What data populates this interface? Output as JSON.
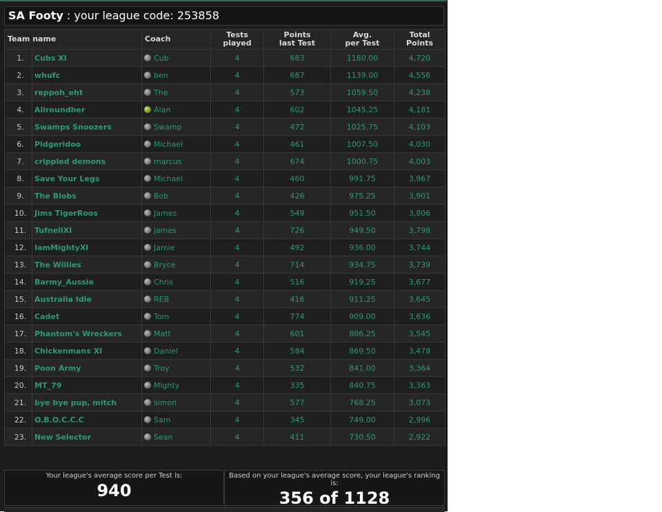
{
  "header": {
    "league_name": "SA Footy",
    "separator": " : ",
    "code_prefix": "your league code: ",
    "code": "253858"
  },
  "columns": {
    "team": "Team name",
    "coach": "Coach",
    "tests_line1": "Tests",
    "tests_line2": "played",
    "points_line1": "Points",
    "points_line2": "last Test",
    "avg_line1": "Avg.",
    "avg_line2": "per Test",
    "total_line1": "Total",
    "total_line2": "Points"
  },
  "rows": [
    {
      "rank": "1.",
      "team": "Cubs XI",
      "coach": "Cub",
      "coach_status": "grey",
      "tests": "4",
      "last": "683",
      "avg": "1180.00",
      "total": "4,720"
    },
    {
      "rank": "2.",
      "team": "whufc",
      "coach": "ben",
      "coach_status": "grey",
      "tests": "4",
      "last": "687",
      "avg": "1139.00",
      "total": "4,556"
    },
    {
      "rank": "3.",
      "team": "reppoh_eht",
      "coach": "The",
      "coach_status": "grey",
      "tests": "4",
      "last": "573",
      "avg": "1059.50",
      "total": "4,238"
    },
    {
      "rank": "4.",
      "team": "Allroundher",
      "coach": "Alan",
      "coach_status": "green",
      "tests": "4",
      "last": "602",
      "avg": "1045.25",
      "total": "4,181"
    },
    {
      "rank": "5.",
      "team": "Swamps Snoozers",
      "coach": "Swamp",
      "coach_status": "grey",
      "tests": "4",
      "last": "472",
      "avg": "1025.75",
      "total": "4,103"
    },
    {
      "rank": "6.",
      "team": "Pidgeridoo",
      "coach": "Michael",
      "coach_status": "grey",
      "tests": "4",
      "last": "461",
      "avg": "1007.50",
      "total": "4,030"
    },
    {
      "rank": "7.",
      "team": "crippled demons",
      "coach": "marcus",
      "coach_status": "grey",
      "tests": "4",
      "last": "674",
      "avg": "1000.75",
      "total": "4,003"
    },
    {
      "rank": "8.",
      "team": "Save Your Legs",
      "coach": "Michael",
      "coach_status": "grey",
      "tests": "4",
      "last": "460",
      "avg": "991.75",
      "total": "3,967"
    },
    {
      "rank": "9.",
      "team": "The Blobs",
      "coach": "Bob",
      "coach_status": "grey",
      "tests": "4",
      "last": "426",
      "avg": "975.25",
      "total": "3,901"
    },
    {
      "rank": "10.",
      "team": "Jims TigerRoos",
      "coach": "James",
      "coach_status": "grey",
      "tests": "4",
      "last": "549",
      "avg": "951.50",
      "total": "3,806"
    },
    {
      "rank": "11.",
      "team": "TufnellXI",
      "coach": "james",
      "coach_status": "grey",
      "tests": "4",
      "last": "726",
      "avg": "949.50",
      "total": "3,798"
    },
    {
      "rank": "12.",
      "team": "IamMightyXI",
      "coach": "Jamie",
      "coach_status": "grey",
      "tests": "4",
      "last": "492",
      "avg": "936.00",
      "total": "3,744"
    },
    {
      "rank": "13.",
      "team": "The Willies",
      "coach": "Bryce",
      "coach_status": "grey",
      "tests": "4",
      "last": "714",
      "avg": "934.75",
      "total": "3,739"
    },
    {
      "rank": "14.",
      "team": "Barmy_Aussie",
      "coach": "Chris",
      "coach_status": "grey",
      "tests": "4",
      "last": "516",
      "avg": "919.25",
      "total": "3,677"
    },
    {
      "rank": "15.",
      "team": "Australia Idle",
      "coach": "REB",
      "coach_status": "grey",
      "tests": "4",
      "last": "416",
      "avg": "911.25",
      "total": "3,645"
    },
    {
      "rank": "16.",
      "team": "Cadet",
      "coach": "Tom",
      "coach_status": "grey",
      "tests": "4",
      "last": "774",
      "avg": "909.00",
      "total": "3,636"
    },
    {
      "rank": "17.",
      "team": "Phantom's Wreckers",
      "coach": "Matt",
      "coach_status": "grey",
      "tests": "4",
      "last": "601",
      "avg": "886.25",
      "total": "3,545"
    },
    {
      "rank": "18.",
      "team": "Chickenmans XI",
      "coach": "Daniel",
      "coach_status": "grey",
      "tests": "4",
      "last": "584",
      "avg": "869.50",
      "total": "3,478"
    },
    {
      "rank": "19.",
      "team": "Poon Army",
      "coach": "Troy",
      "coach_status": "grey",
      "tests": "4",
      "last": "532",
      "avg": "841.00",
      "total": "3,364"
    },
    {
      "rank": "20.",
      "team": "MT_79",
      "coach": "Mighty",
      "coach_status": "grey",
      "tests": "4",
      "last": "335",
      "avg": "840.75",
      "total": "3,363"
    },
    {
      "rank": "21.",
      "team": "bye bye pup, mitch",
      "coach": "simon",
      "coach_status": "grey",
      "tests": "4",
      "last": "577",
      "avg": "768.25",
      "total": "3,073"
    },
    {
      "rank": "22.",
      "team": "O.B.O.C.C.C",
      "coach": "Sam",
      "coach_status": "grey",
      "tests": "4",
      "last": "345",
      "avg": "749.00",
      "total": "2,996"
    },
    {
      "rank": "23.",
      "team": "New Selector",
      "coach": "Sean",
      "coach_status": "grey",
      "tests": "4",
      "last": "411",
      "avg": "730.50",
      "total": "2,922"
    }
  ],
  "stats": {
    "avg_label": "Your league's average score per Test is:",
    "avg_value": "940",
    "ranking_label": "Based on your league's average score, your league's ranking is:",
    "ranking_value": "356 of 1128"
  },
  "colors": {
    "accent": "#2e9a6e",
    "background": "#1c1c1c",
    "text": "#ffffff"
  }
}
